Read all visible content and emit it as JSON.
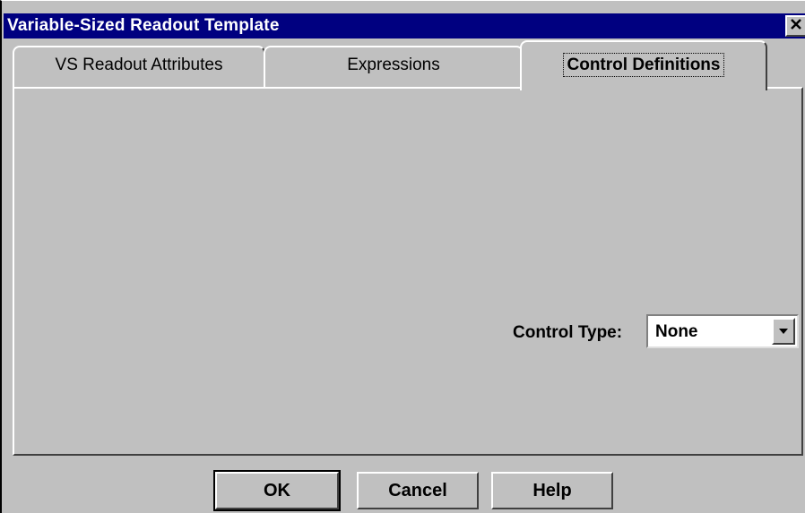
{
  "window": {
    "title": "Variable-Sized Readout Template",
    "close_icon": "close-icon"
  },
  "tabs": [
    {
      "label": "VS Readout Attributes",
      "active": false
    },
    {
      "label": "Expressions",
      "active": false
    },
    {
      "label": "Control Definitions",
      "active": true
    }
  ],
  "control_definitions": {
    "control_type_label": "Control Type:",
    "control_type_value": "None",
    "dropdown_icon": "chevron-down-icon"
  },
  "buttons": {
    "ok": "OK",
    "cancel": "Cancel",
    "help": "Help"
  }
}
